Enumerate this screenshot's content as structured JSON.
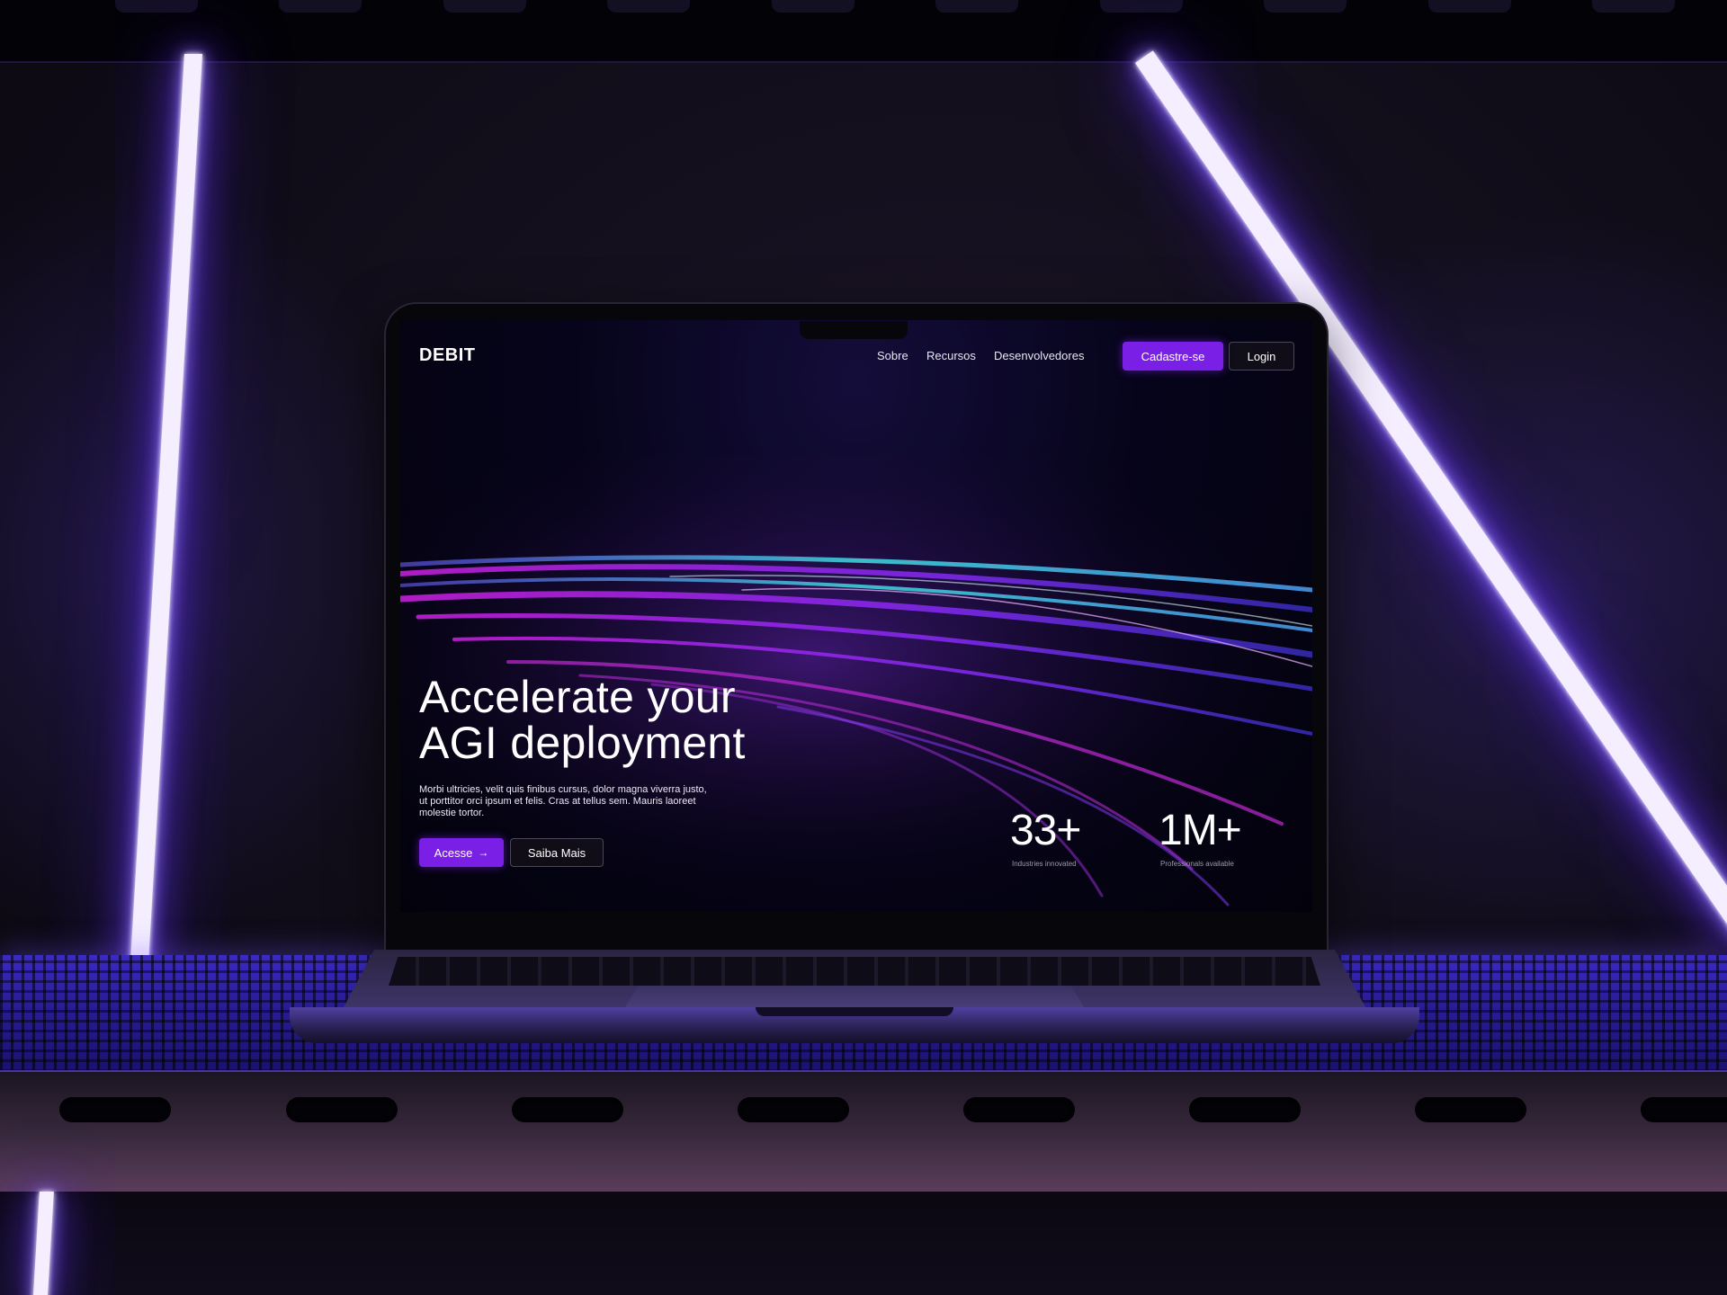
{
  "site": {
    "logo": "DEBIT",
    "nav": {
      "links": [
        "Sobre",
        "Recursos",
        "Desenvolvedores"
      ],
      "signup_label": "Cadastre-se",
      "login_label": "Login"
    },
    "hero": {
      "title_line1": "Accelerate your",
      "title_line2": "AGI deployment",
      "body": "Morbi ultricies, velit quis finibus cursus, dolor magna viverra justo, ut porttitor orci ipsum et felis. Cras at tellus sem. Mauris laoreet molestie tortor.",
      "primary_cta": "Acesse",
      "primary_cta_icon": "arrow-right-icon",
      "secondary_cta": "Saiba Mais"
    },
    "stats": [
      {
        "value": "33+",
        "label": "Industries innovated"
      },
      {
        "value": "1M+",
        "label": "Professionals available"
      }
    ]
  },
  "colors": {
    "accent": "#7a1fe6",
    "neon": "#f4eeff",
    "neon_glow": "#6a3dff",
    "shelf": "#2a1c9c",
    "screen_bg": "#06041a"
  }
}
